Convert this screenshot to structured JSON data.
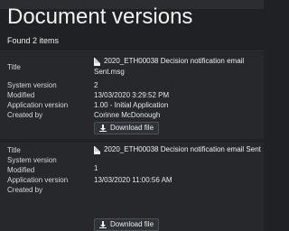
{
  "page": {
    "title": "Document versions",
    "found_text": "Found 2 items"
  },
  "labels": {
    "title": "Title",
    "system_version": "System version",
    "modified": "Modified",
    "application_version": "Application version",
    "created_by": "Created by"
  },
  "versions": [
    {
      "file_name_line1": "2020_ETH00038 Decision notification email",
      "file_name_line2": "Sent.msg",
      "system_version": "2",
      "modified": "13/03/2020 3:29:52 PM",
      "application_version": "1.00 - Initial Application",
      "created_by": "Corinne McDonough",
      "download_label": "Download file"
    },
    {
      "file_name_line1": "2020_ETH00038 Decision notification email Sent",
      "system_version": "1",
      "modified": "13/03/2020 11:00:56 AM",
      "application_version": "",
      "created_by": "",
      "download_label": "Download file"
    }
  ],
  "icons": {
    "file": "file-icon",
    "download": "download-icon"
  },
  "colors": {
    "background": "#1f2124",
    "card": "#26282c",
    "text": "#e8e8e8"
  }
}
